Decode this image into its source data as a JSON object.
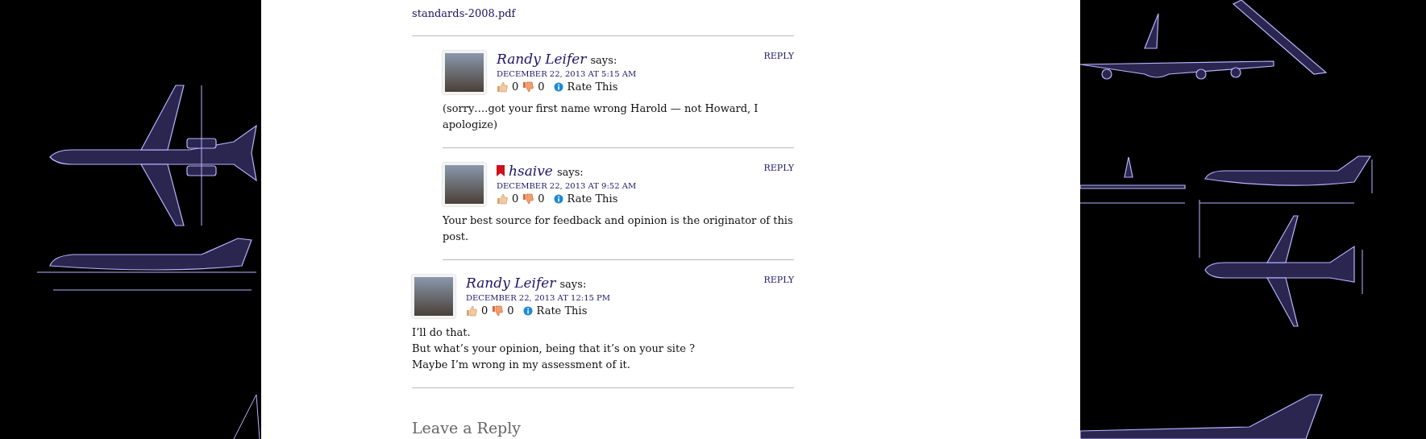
{
  "link_tail": "standards-2008.pdf",
  "nested_replies": [
    {
      "author": "Randy Leifer",
      "flagged": false,
      "says": "says:",
      "date": "DECEMBER 22, 2013 AT 5:15 AM",
      "likes": "0",
      "dislikes": "0",
      "rate_label": "Rate This",
      "reply_label": "REPLY",
      "body": [
        "(sorry….got your first name wrong Harold — not Howard, I apologize)"
      ]
    },
    {
      "author": "hsaive",
      "flagged": true,
      "says": "says:",
      "date": "DECEMBER 22, 2013 AT 9:52 AM",
      "likes": "0",
      "dislikes": "0",
      "rate_label": "Rate This",
      "reply_label": "REPLY",
      "body": [
        "Your best source for feedback and opinion is the originator of this post."
      ]
    }
  ],
  "comments": [
    {
      "author": "Randy Leifer",
      "flagged": false,
      "says": "says:",
      "date": "DECEMBER 22, 2013 AT 12:15 PM",
      "likes": "0",
      "dislikes": "0",
      "rate_label": "Rate This",
      "reply_label": "REPLY",
      "body": [
        "I’ll do that.",
        "But what’s your opinion, being that it’s on your site ?",
        "Maybe I’m wrong in my assessment of it."
      ]
    }
  ],
  "reply_heading": "Leave a Reply"
}
